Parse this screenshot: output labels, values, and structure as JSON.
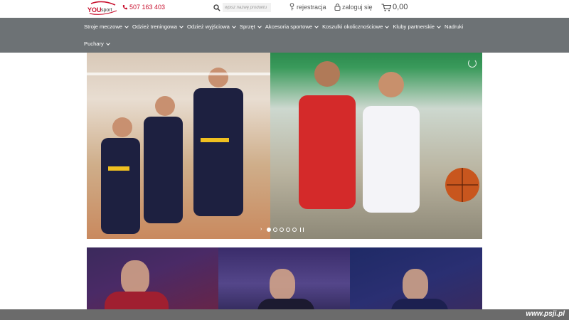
{
  "header": {
    "logo_text": "YOUsport",
    "phone": "507 163 403",
    "search": {
      "placeholder": "wpisz nazwę produktu"
    },
    "register_label": "rejestracja",
    "login_label": "zaloguj się",
    "cart_total": "0,00"
  },
  "nav": {
    "row1": [
      {
        "label": "Stroje meczowe",
        "dropdown": true
      },
      {
        "label": "Odzież treningowa",
        "dropdown": true
      },
      {
        "label": "Odzież wyjściowa",
        "dropdown": true
      },
      {
        "label": "Sprzęt",
        "dropdown": true
      },
      {
        "label": "Akcesoria sportowe",
        "dropdown": true
      },
      {
        "label": "Koszulki okolicznościowe",
        "dropdown": true
      },
      {
        "label": "Kluby partnerskie",
        "dropdown": true
      },
      {
        "label": "Nadruki",
        "dropdown": false
      }
    ],
    "row2": [
      {
        "label": "Puchary",
        "dropdown": true
      }
    ]
  },
  "slider": {
    "slide_count": 5,
    "active_index": 0
  },
  "watermark": "www.psji.pl",
  "colors": {
    "nav_bg": "#6d7275",
    "accent_red": "#c8102e"
  }
}
